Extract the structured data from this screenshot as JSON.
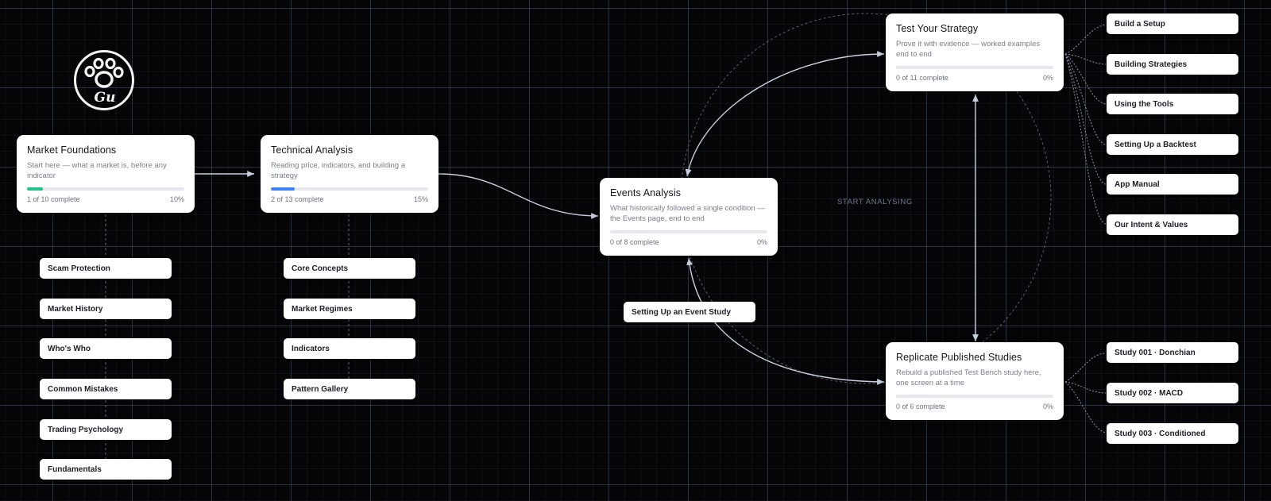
{
  "center_label": "START ANALYSING",
  "logo": {
    "text": "Gu",
    "icon": "paw-icon"
  },
  "colors": {
    "green": "#22c08a",
    "blue": "#3b82f6",
    "track": "#e6e8ee"
  },
  "cards": {
    "market_foundations": {
      "title": "Market Foundations",
      "desc": "Start here — what a market is, before any indicator",
      "count": "1 of 10 complete",
      "pct_label": "10%",
      "progress": 0.1
    },
    "technical_analysis": {
      "title": "Technical Analysis",
      "desc": "Reading price, indicators, and building a strategy",
      "count": "2 of 13 complete",
      "pct_label": "15%",
      "progress": 0.15
    },
    "events_analysis": {
      "title": "Events Analysis",
      "desc": "What historically followed a single condition — the Events page, end to end",
      "count": "0 of 8 complete",
      "pct_label": "0%",
      "progress": 0
    },
    "test_strategy": {
      "title": "Test Your Strategy",
      "desc": "Prove it with evidence — worked examples end to end",
      "count": "0 of 11 complete",
      "pct_label": "0%",
      "progress": 0
    },
    "replicate_studies": {
      "title": "Replicate Published Studies",
      "desc": "Rebuild a published Test Bench study here, one screen at a time",
      "count": "0 of 6 complete",
      "pct_label": "0%",
      "progress": 0
    }
  },
  "foundations_topics": [
    "Scam Protection",
    "Market History",
    "Who's Who",
    "Common Mistakes",
    "Trading Psychology",
    "Fundamentals"
  ],
  "technical_topics": [
    "Core Concepts",
    "Market Regimes",
    "Indicators",
    "Pattern Gallery"
  ],
  "events_topics": [
    "Setting Up an Event Study"
  ],
  "strategy_topics": [
    "Build a Setup",
    "Building Strategies",
    "Using the Tools",
    "Setting Up a Backtest",
    "App Manual",
    "Our Intent & Values"
  ],
  "study_topics": [
    "Study 001 · Donchian",
    "Study 002 · MACD",
    "Study 003 · Conditioned"
  ]
}
